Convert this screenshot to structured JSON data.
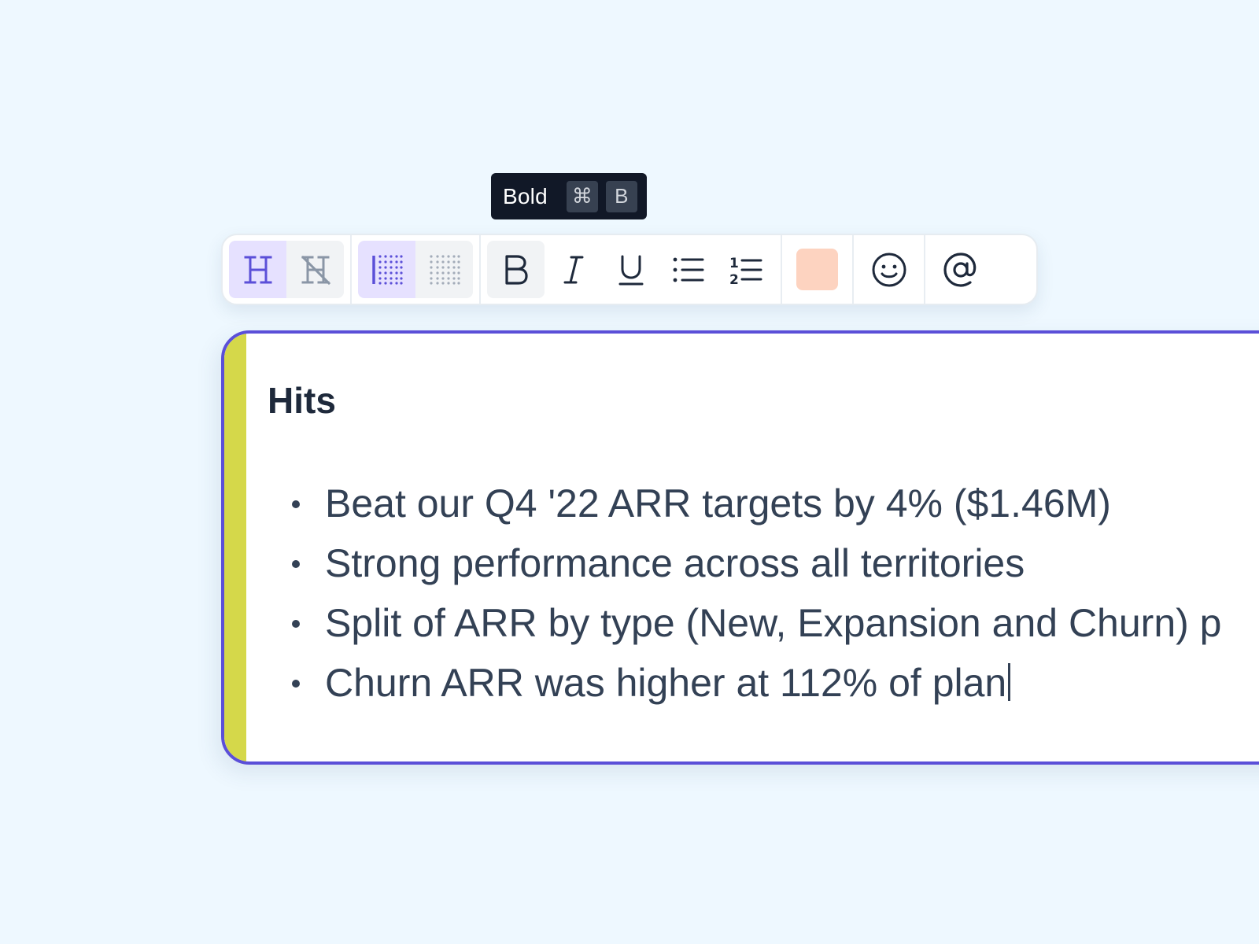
{
  "tooltip": {
    "label": "Bold",
    "keys": [
      "⌘",
      "B"
    ]
  },
  "toolbar": {
    "heading_toggle": [
      "heading-icon",
      "no-heading-icon"
    ],
    "border_toggle": [
      "left-border-icon",
      "no-border-icon"
    ],
    "format_buttons": [
      "bold-icon",
      "italic-icon",
      "underline-icon",
      "bullet-list-icon",
      "numbered-list-icon"
    ],
    "highlight_color": "#fdd3c0",
    "emoji_icon": "emoji-icon",
    "mention_icon": "at-sign-icon",
    "accent_color": "#5b4fd8"
  },
  "card": {
    "title": "Hits",
    "accent_color": "#d5d84a",
    "bullets": [
      "Beat our Q4 '22 ARR targets by 4% ($1.46M)",
      "Strong performance across all territories",
      "Split of ARR by type (New, Expansion and Churn) p",
      "Churn ARR was higher at 112% of plan"
    ]
  }
}
